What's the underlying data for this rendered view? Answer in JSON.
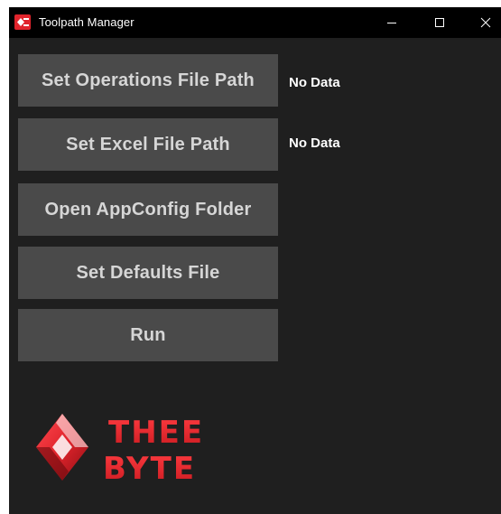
{
  "window": {
    "title": "Toolpath Manager"
  },
  "buttons": {
    "set_operations_file_path": "Set Operations File Path",
    "set_excel_file_path": "Set Excel File Path",
    "open_appconfig_folder": "Open AppConfig Folder",
    "set_defaults_file": "Set Defaults File",
    "run": "Run"
  },
  "status": {
    "operations_file_path": "No Data",
    "excel_file_path": "No Data"
  },
  "logo": {
    "line1": "THEE",
    "line2": "BYTE"
  },
  "icons": {
    "app": "thee-byte-app-icon",
    "minimize": "minimize-icon",
    "maximize": "maximize-icon",
    "close": "close-icon",
    "logo_mark": "red-diamond-logo-icon"
  },
  "colors": {
    "window_background": "#1f1f1f",
    "titlebar": "#000000",
    "button_background": "#4a4a4a",
    "button_text": "#d6d6d6",
    "status_text": "#ffffff",
    "brand_red": "#e0242c"
  }
}
